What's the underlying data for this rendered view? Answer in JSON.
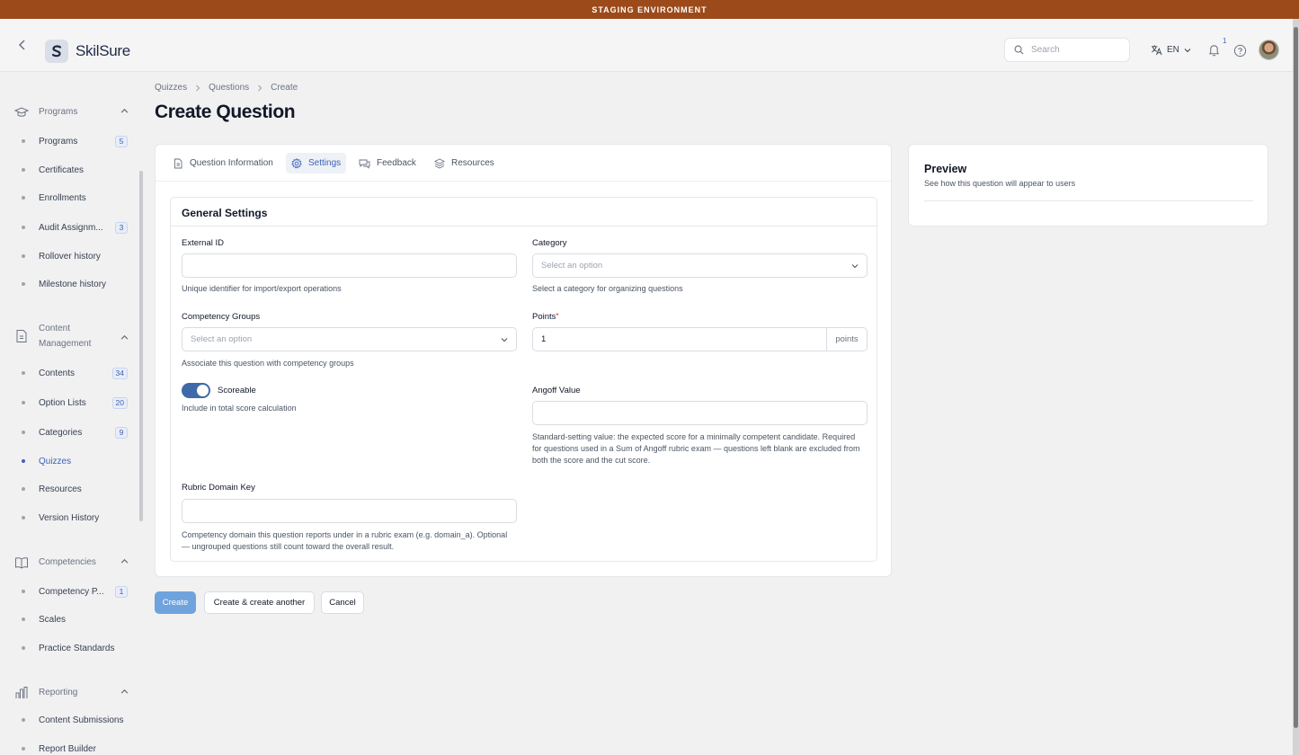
{
  "banner": "STAGING ENVIRONMENT",
  "brand": {
    "name": "SkilSure"
  },
  "header": {
    "search_placeholder": "Search",
    "language": "EN",
    "notifications_count": "1"
  },
  "sidebar": {
    "groups": [
      {
        "label": "Programs",
        "icon": "graduation-cap-icon",
        "items": [
          {
            "label": "Programs",
            "badge": "5"
          },
          {
            "label": "Certificates"
          },
          {
            "label": "Enrollments"
          },
          {
            "label": "Audit Assignm...",
            "badge": "3"
          },
          {
            "label": "Rollover history"
          },
          {
            "label": "Milestone history"
          }
        ]
      },
      {
        "label": "Content Management",
        "icon": "document-icon",
        "items": [
          {
            "label": "Contents",
            "badge": "34"
          },
          {
            "label": "Option Lists",
            "badge": "20"
          },
          {
            "label": "Categories",
            "badge": "9"
          },
          {
            "label": "Quizzes",
            "active": true
          },
          {
            "label": "Resources"
          },
          {
            "label": "Version History"
          }
        ]
      },
      {
        "label": "Competencies",
        "icon": "book-icon",
        "items": [
          {
            "label": "Competency P...",
            "badge": "1"
          },
          {
            "label": "Scales"
          },
          {
            "label": "Practice Standards"
          }
        ]
      },
      {
        "label": "Reporting",
        "icon": "bar-chart-icon",
        "items": [
          {
            "label": "Content Submissions"
          },
          {
            "label": "Report Builder"
          }
        ]
      }
    ]
  },
  "breadcrumb": [
    "Quizzes",
    "Questions",
    "Create"
  ],
  "page_title": "Create Question",
  "tabs": [
    {
      "label": "Question Information",
      "icon": "file-icon"
    },
    {
      "label": "Settings",
      "icon": "gear-icon",
      "active": true
    },
    {
      "label": "Feedback",
      "icon": "chat-icon"
    },
    {
      "label": "Resources",
      "icon": "stack-icon"
    }
  ],
  "form": {
    "section_title": "General Settings",
    "external_id": {
      "label": "External ID",
      "value": "",
      "hint": "Unique identifier for import/export operations"
    },
    "category": {
      "label": "Category",
      "placeholder": "Select an option",
      "hint": "Select a category for organizing questions"
    },
    "competency_groups": {
      "label": "Competency Groups",
      "placeholder": "Select an option",
      "hint": "Associate this question with competency groups"
    },
    "points": {
      "label": "Points",
      "required": "*",
      "value": "1",
      "suffix": "points"
    },
    "scoreable": {
      "label": "Scoreable",
      "checked": true,
      "hint": "Include in total score calculation"
    },
    "angoff": {
      "label": "Angoff Value",
      "value": "",
      "hint": "Standard-setting value: the expected score for a minimally competent candidate. Required for questions used in a Sum of Angoff rubric exam — questions left blank are excluded from both the score and the cut score."
    },
    "rubric_domain_key": {
      "label": "Rubric Domain Key",
      "value": "",
      "hint": "Competency domain this question reports under in a rubric exam (e.g. domain_a). Optional — ungrouped questions still count toward the overall result."
    }
  },
  "actions": {
    "create": "Create",
    "create_another": "Create & create another",
    "cancel": "Cancel"
  },
  "preview": {
    "title": "Preview",
    "subtitle": "See how this question will appear to users"
  },
  "colors": {
    "banner": "#9c4a1a",
    "accent": "#3d62b7",
    "toggle_on": "#3f6aa9",
    "primary_button": "#6fa3de"
  }
}
